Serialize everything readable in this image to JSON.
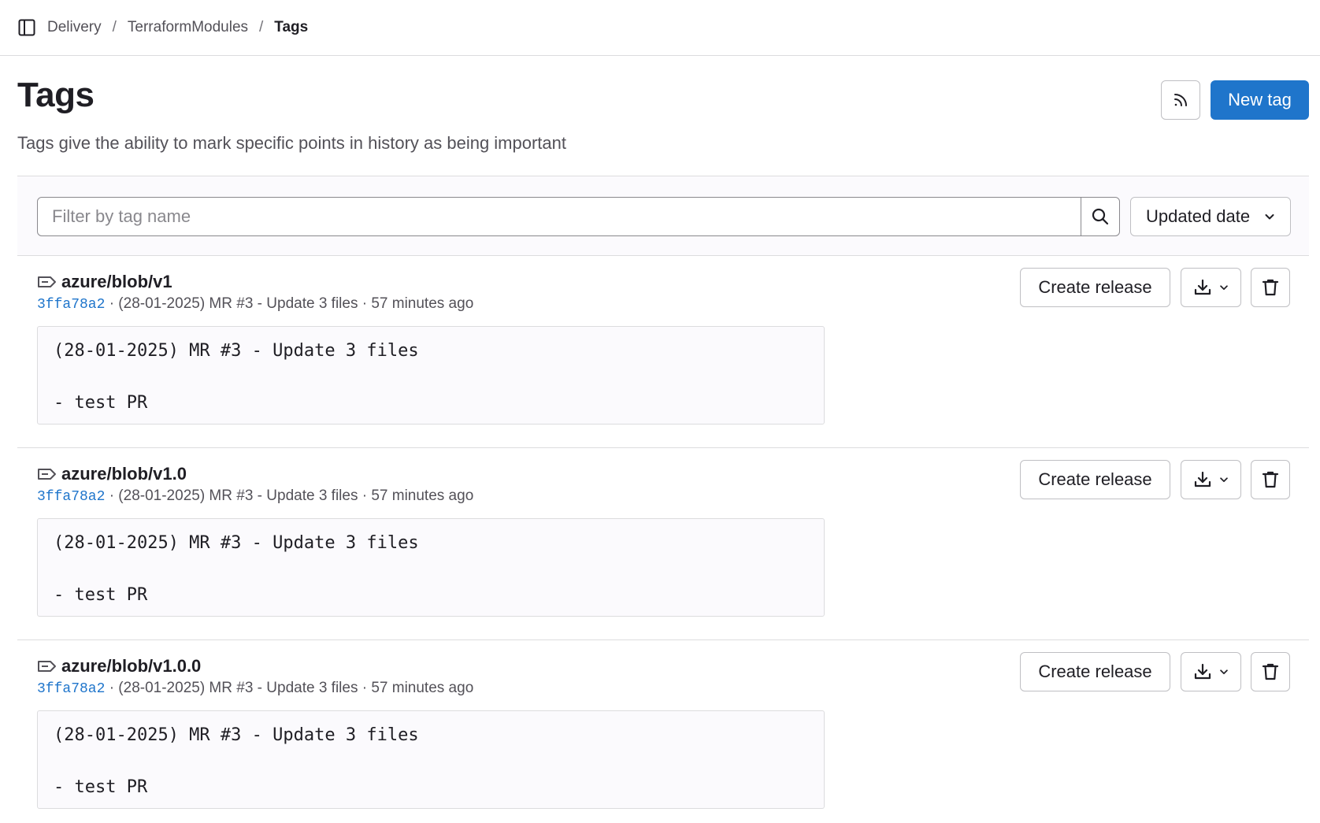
{
  "breadcrumb": {
    "items": [
      "Delivery",
      "TerraformModules"
    ],
    "current": "Tags"
  },
  "header": {
    "title": "Tags",
    "description": "Tags give the ability to mark specific points in history as being important",
    "new_tag_label": "New tag"
  },
  "filter": {
    "placeholder": "Filter by tag name",
    "value": "",
    "sort_label": "Updated date"
  },
  "tags": [
    {
      "name": "azure/blob/v1",
      "sha": "3ffa78a2",
      "commit_info": " · (28-01-2025) MR #3 - Update 3 files · 57 minutes ago",
      "message_line1": "(28-01-2025) MR #3 - Update 3 files",
      "message_line2": "- test PR",
      "create_release_label": "Create release"
    },
    {
      "name": "azure/blob/v1.0",
      "sha": "3ffa78a2",
      "commit_info": " · (28-01-2025) MR #3 - Update 3 files · 57 minutes ago",
      "message_line1": "(28-01-2025) MR #3 - Update 3 files",
      "message_line2": "- test PR",
      "create_release_label": "Create release"
    },
    {
      "name": "azure/blob/v1.0.0",
      "sha": "3ffa78a2",
      "commit_info": " · (28-01-2025) MR #3 - Update 3 files · 57 minutes ago",
      "message_line1": "(28-01-2025) MR #3 - Update 3 files",
      "message_line2": "- test PR",
      "create_release_label": "Create release"
    }
  ],
  "icons": {
    "sidebar_toggle": "sidebar-icon",
    "rss": "rss-icon",
    "search": "search-icon",
    "chevron": "chevron-down-icon",
    "tag": "tag-icon",
    "download": "download-icon",
    "delete": "trash-icon"
  },
  "colors": {
    "primary": "#1f75cb",
    "text": "#1f1e24",
    "muted": "#535158",
    "border": "#dcdcde",
    "subtle_bg": "#fbfafd"
  }
}
